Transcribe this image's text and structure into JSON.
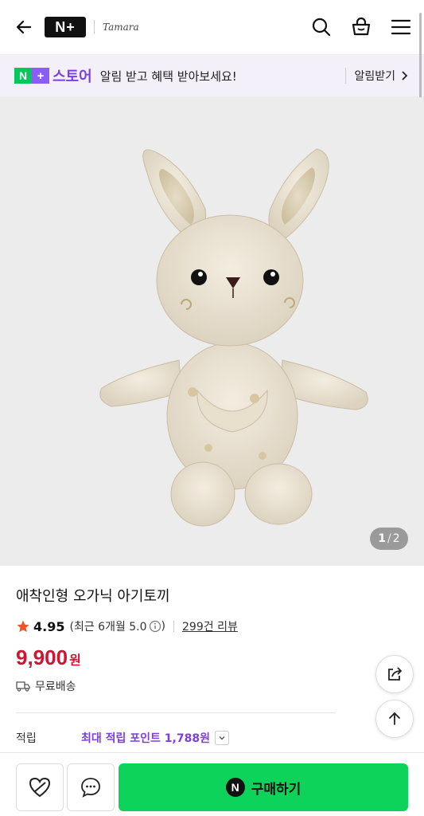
{
  "header": {
    "logo": "N+",
    "brand": "Tamara",
    "icons": [
      "back-arrow-icon",
      "search-icon",
      "cart-icon",
      "menu-icon"
    ]
  },
  "banner": {
    "store_label": "스토어",
    "message": "알림 받고 혜택 받아보세요!",
    "subscribe_label": "알림받기"
  },
  "gallery": {
    "current": "1",
    "separator": "/",
    "total": "2"
  },
  "product": {
    "title": "애착인형 오가닉 아기토끼",
    "rating": "4.95",
    "recent_rating": "(최근 6개월 5.0",
    "recent_close": ")",
    "reviews": "299건 리뷰",
    "price": "9,900",
    "currency": "원",
    "shipping": "무료배송",
    "points_label": "적립",
    "points_value": "최대 적립 포인트 1,788원"
  },
  "bottom_bar": {
    "buy_label": "구매하기",
    "buy_badge": "N"
  },
  "colors": {
    "accent_green": "#0ed35b",
    "price_red": "#d11433",
    "store_purple": "#7b3fe4",
    "star": "#f0542a"
  }
}
